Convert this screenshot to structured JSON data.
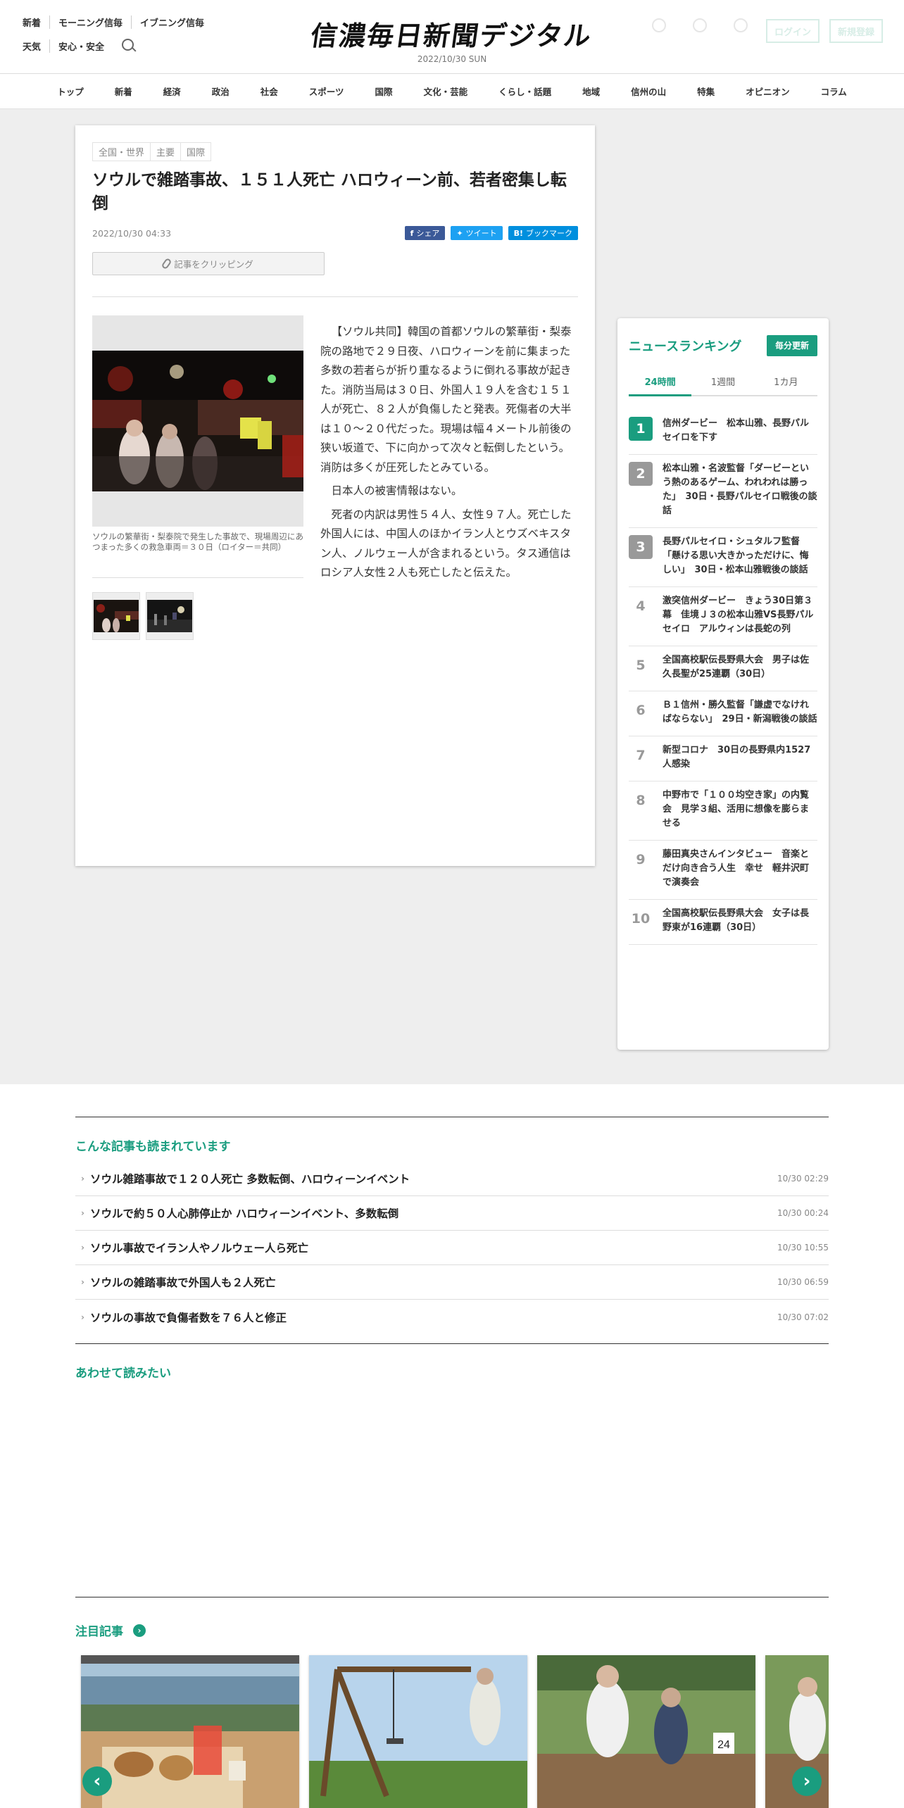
{
  "header": {
    "row1": [
      "新着",
      "モーニング信毎",
      "イブニング信毎"
    ],
    "row2": [
      "天気",
      "安心・安全"
    ],
    "logo": "信濃毎日新聞デジタル",
    "date": "2022/10/30 SUN",
    "login": "ログイン",
    "register": "新規登録"
  },
  "nav": [
    "トップ",
    "新着",
    "経済",
    "政治",
    "社会",
    "スポーツ",
    "国際",
    "文化・芸能",
    "くらし・話題",
    "地域",
    "信州の山",
    "特集",
    "オピニオン",
    "コラム"
  ],
  "article": {
    "categories": [
      "全国・世界",
      "主要",
      "国際"
    ],
    "title": "ソウルで雑踏事故、１５１人死亡 ハロウィーン前、若者密集し転倒",
    "date": "2022/10/30 04:33",
    "share_fb": "シェア",
    "share_tw": "ツイート",
    "share_hb": "ブックマーク",
    "clip": "記事をクリッピング",
    "caption": "ソウルの繁華街・梨泰院で発生した事故で、現場周辺にあつまった多くの救急車両＝３０日（ロイター＝共同）",
    "paragraphs": [
      "【ソウル共同】韓国の首都ソウルの繁華街・梨泰院の路地で２９日夜、ハロウィーンを前に集まった多数の若者らが折り重なるように倒れる事故が起きた。消防当局は３０日、外国人１９人を含む１５１人が死亡、８２人が負傷したと発表。死傷者の大半は１０～２０代だった。現場は幅４メートル前後の狭い坂道で、下に向かって次々と転倒したという。消防は多くが圧死したとみている。",
      "日本人の被害情報はない。",
      "死者の内訳は男性５４人、女性９７人。死亡した外国人には、中国人のほかイラン人とウズベキスタン人、ノルウェー人が含まれるという。タス通信はロシア人女性２人も死亡したと伝えた。"
    ]
  },
  "ranking": {
    "title": "ニュースランキング",
    "badge": "毎分更新",
    "tabs": [
      "24時間",
      "1週間",
      "1カ月"
    ],
    "items": [
      {
        "rank": "1",
        "text": "信州ダービー　松本山雅、長野パルセイロを下す"
      },
      {
        "rank": "2",
        "text": "松本山雅・名波監督「ダービーという熱のあるゲーム、われわれは勝った」　30日・長野パルセイロ戦後の談話"
      },
      {
        "rank": "3",
        "text": "長野パルセイロ・シュタルフ監督「懸ける思い大きかっただけに、悔しい」　30日・松本山雅戦後の談話"
      },
      {
        "rank": "4",
        "text": "激突信州ダービー　きょう30日第３幕　佳境Ｊ３の松本山雅VS長野パルセイロ　アルウィンは長蛇の列"
      },
      {
        "rank": "5",
        "text": "全国高校駅伝長野県大会　男子は佐久長聖が25連覇（30日）"
      },
      {
        "rank": "6",
        "text": "Ｂ１信州・勝久監督「謙虚でなければならない」　29日・新潟戦後の談話"
      },
      {
        "rank": "7",
        "text": "新型コロナ　30日の長野県内1527人感染"
      },
      {
        "rank": "8",
        "text": "中野市で「１００均空き家」の内覧会　見学３組、活用に想像を膨らませる"
      },
      {
        "rank": "9",
        "text": "藤田真央さんインタビュー　音楽とだけ向き合う人生　幸せ　軽井沢町で演奏会"
      },
      {
        "rank": "10",
        "text": "全国高校駅伝長野県大会　女子は長野東が16連覇（30日）"
      }
    ]
  },
  "related": {
    "title": "こんな記事も読まれています",
    "items": [
      {
        "title": "ソウル雑踏事故で１２０人死亡 多数転倒、ハロウィーンイベント",
        "date": "10/30 02:29"
      },
      {
        "title": "ソウルで約５０人心肺停止か ハロウィーンイベント、多数転倒",
        "date": "10/30 00:24"
      },
      {
        "title": "ソウル事故でイラン人やノルウェー人ら死亡",
        "date": "10/30 10:55"
      },
      {
        "title": "ソウルの雑踏事故で外国人も２人死亡",
        "date": "10/30 06:59"
      },
      {
        "title": "ソウルの事故で負傷者数を７６人と修正",
        "date": "10/30 07:02"
      }
    ]
  },
  "also_read": {
    "title": "あわせて読みたい"
  },
  "featured": {
    "title": "注目記事",
    "prev": "‹",
    "next": "›"
  }
}
